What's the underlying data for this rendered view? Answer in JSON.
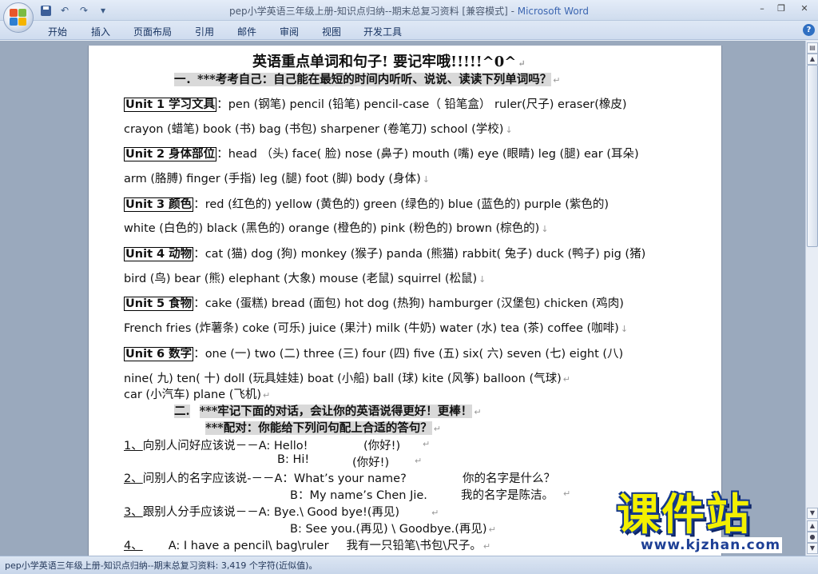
{
  "window": {
    "title_doc": "pep小学英语三年级上册-知识点归纳--期末总复习资料 [兼容模式] - ",
    "title_app": "Microsoft Word",
    "minimize": "–",
    "restore": "❐",
    "close": "✕"
  },
  "qat": {
    "undo": "↶",
    "redo": "↷",
    "more": "▾"
  },
  "menu": {
    "tabs": [
      "开始",
      "插入",
      "页面布局",
      "引用",
      "邮件",
      "审阅",
      "视图",
      "开发工具"
    ],
    "help": "?"
  },
  "doc": {
    "title": "英语重点单词和句子!  要记牢哦!!!!!^0^",
    "sec1": "一．***考考自己：自己能在最短的时间内听听、说说、读读下列单词吗？",
    "units": [
      {
        "label": "Unit 1 学习文具",
        "sep": "：",
        "l1": "pen (钢笔)     pencil (铅笔)     pencil-case（ 铅笔盒）    ruler(尺子)     eraser(橡皮)",
        "l2": "crayon (蜡笔)    book (书)     bag (书包)     sharpener (卷笔刀)    school (学校)"
      },
      {
        "label": "Unit 2 身体部位",
        "sep": "：",
        "l1": "head （头)     face( 脸)   nose (鼻子)     mouth (嘴)     eye (眼睛)     leg (腿)     ear (耳朵)",
        "l2": "arm (胳膊)     finger (手指)     leg (腿)     foot (脚)    body (身体)"
      },
      {
        "label": "Unit 3 颜色",
        "sep": "：",
        "l1": "red (红色的)    yellow (黄色的)     green (绿色的)    blue (蓝色的)    purple (紫色的)",
        "l2": "white (白色的)    black (黑色的)     orange (橙色的) pink (粉色的)    brown (棕色的)"
      },
      {
        "label": "Unit 4 动物",
        "sep": "：",
        "l1": "cat (猫)     dog (狗)     monkey (猴子)     panda (熊猫)    rabbit( 兔子) duck (鸭子)      pig (猪)",
        "l2": "bird (鸟)     bear (熊)    elephant (大象)     mouse (老鼠)     squirrel (松鼠)"
      },
      {
        "label": "Unit 5 食物",
        "sep": "：",
        "l1": "cake (蛋糕)    bread (面包)    hot dog (热狗)    hamburger (汉堡包)      chicken (鸡肉)",
        "l2": "French fries (炸薯条)    coke (可乐)    juice (果汁)     milk (牛奶)      water (水)    tea (茶)    coffee (咖啡)"
      },
      {
        "label": "Unit 6 数字",
        "sep": "：",
        "l1": "one (一)     two (二)      three (三)      four (四)    five (五)     six( 六)     seven (七)    eight (八)",
        "l2": "nine( 九)     ten( 十)      doll (玩具娃娃)      boat (小船)     ball (球)    kite (风筝)    balloon (气球)"
      }
    ],
    "extra": "car (小汽车)      plane (飞机)",
    "sec2a_num": "二.",
    "sec2a": "***牢记下面的对话，会让你的英语说得更好！更棒！",
    "sec2b": "***配对：你能给下列问句配上合适的答句？",
    "q": [
      {
        "num": "1、",
        "q": "向别人问好应该说－－A: Hello!",
        "qcn": "(你好!)",
        "a": "B: Hi!",
        "acn": "(你好!)"
      },
      {
        "num": "2、",
        "q": "问别人的名字应该说-－－A：What’s your name?",
        "qcn": "你的名字是什么？",
        "a": "B：My name’s Chen Jie.",
        "acn": "我的名字是陈洁。"
      },
      {
        "num": "3、",
        "q": "跟别人分手应该说－－A: Bye.\\ Good bye!(再见)",
        "qcn": "",
        "a": "B: See you.(再见)    \\ Goodbye.(再见)",
        "acn": ""
      },
      {
        "num": "4、",
        "q": "A: I have a pencil\\ bag\\ruler",
        "qcn": "我有一只铅笔\\书包\\尺子。",
        "a": "",
        "acn": ""
      }
    ]
  },
  "logo": {
    "cn": "课件站",
    "url": "www.kjzhan.com"
  },
  "status": {
    "text": "pep小学英语三年级上册-知识点归纳--期末总复习资料: 3,419 个字符(近似值)。"
  },
  "marks": {
    "para": "↵",
    "break": "↓"
  }
}
